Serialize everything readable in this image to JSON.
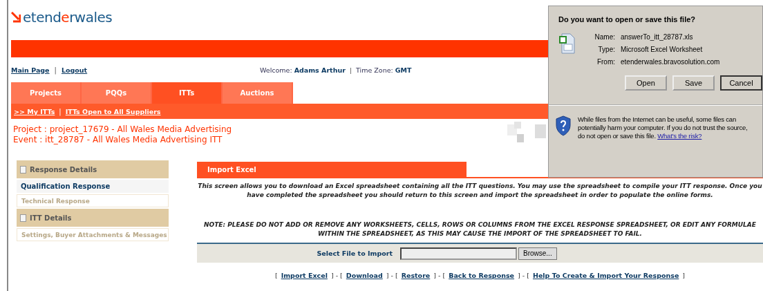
{
  "logo": {
    "part_1": "etend",
    "part_2": "e",
    "part_3": "rwales"
  },
  "nav_links": [
    "Main Page",
    "Logout"
  ],
  "nav_separator": "|",
  "welcome": {
    "label": "Welcome:",
    "name": "Adams Arthur",
    "separator": "|",
    "tz_label": "Time Zone:",
    "tz": "GMT"
  },
  "tabs": [
    {
      "label": "Projects",
      "selected": false
    },
    {
      "label": "PQQs",
      "selected": false
    },
    {
      "label": "ITTs",
      "selected": true
    },
    {
      "label": "Auctions",
      "selected": false
    }
  ],
  "sub_links": [
    ">> My ITTs",
    "ITTs Open to All Suppliers"
  ],
  "sub_separator": "|",
  "project_line": "Project : project_17679 - All Wales Media Advertising",
  "event_line": "Event : itt_28787 - All Wales Media Advertising ITT",
  "sidebar": [
    {
      "kind": "section",
      "label": "Response Details"
    },
    {
      "kind": "item",
      "label": "Qualification Response",
      "disabled": false
    },
    {
      "kind": "item",
      "label": "Technical Response",
      "disabled": true
    },
    {
      "kind": "section",
      "label": "ITT Details"
    },
    {
      "kind": "item",
      "label": "Settings, Buyer Attachments & Messages",
      "disabled": true
    }
  ],
  "panel": {
    "title": "Import Excel",
    "intro": "This screen allows you to download an Excel spreadsheet containing all the ITT questions. You may use the spreadsheet to compile your ITT response. Once you have completed the spreadsheet you should return to this screen and import the spreadsheet in order to populate the online forms.",
    "note": "NOTE: PLEASE DO NOT ADD OR REMOVE ANY WORKSHEETS, CELLS, ROWS OR COLUMNS FROM THE EXCEL RESPONSE SPREADSHEET, OR EDIT ANY FORMULAE WITHIN THE SPREADSHEET, AS THIS MAY CAUSE THE IMPORT OF THE SPREADSHEET TO FAIL.",
    "file_label": "Select File to Import",
    "browse": "Browse...",
    "action_open": "[",
    "action_joiner": "] - [",
    "action_close": "]",
    "actions": [
      "Import Excel",
      "Download",
      "Restore",
      "Back to Response",
      "Help To Create & Import Your Response"
    ]
  },
  "dialog": {
    "question": "Do you want to open or save this file?",
    "fields": [
      {
        "label": "Name:",
        "value": "answerTo_itt_28787.xls"
      },
      {
        "label": "Type:",
        "value": "Microsoft Excel Worksheet"
      },
      {
        "label": "From:",
        "value": "etenderwales.bravosolution.com"
      }
    ],
    "buttons": [
      "Open",
      "Save",
      "Cancel"
    ],
    "warning": "While files from the Internet can be useful, some files can potentially harm your computer. If you do not trust the source, do not open or save this file.",
    "risk_link": "What's the risk?"
  }
}
